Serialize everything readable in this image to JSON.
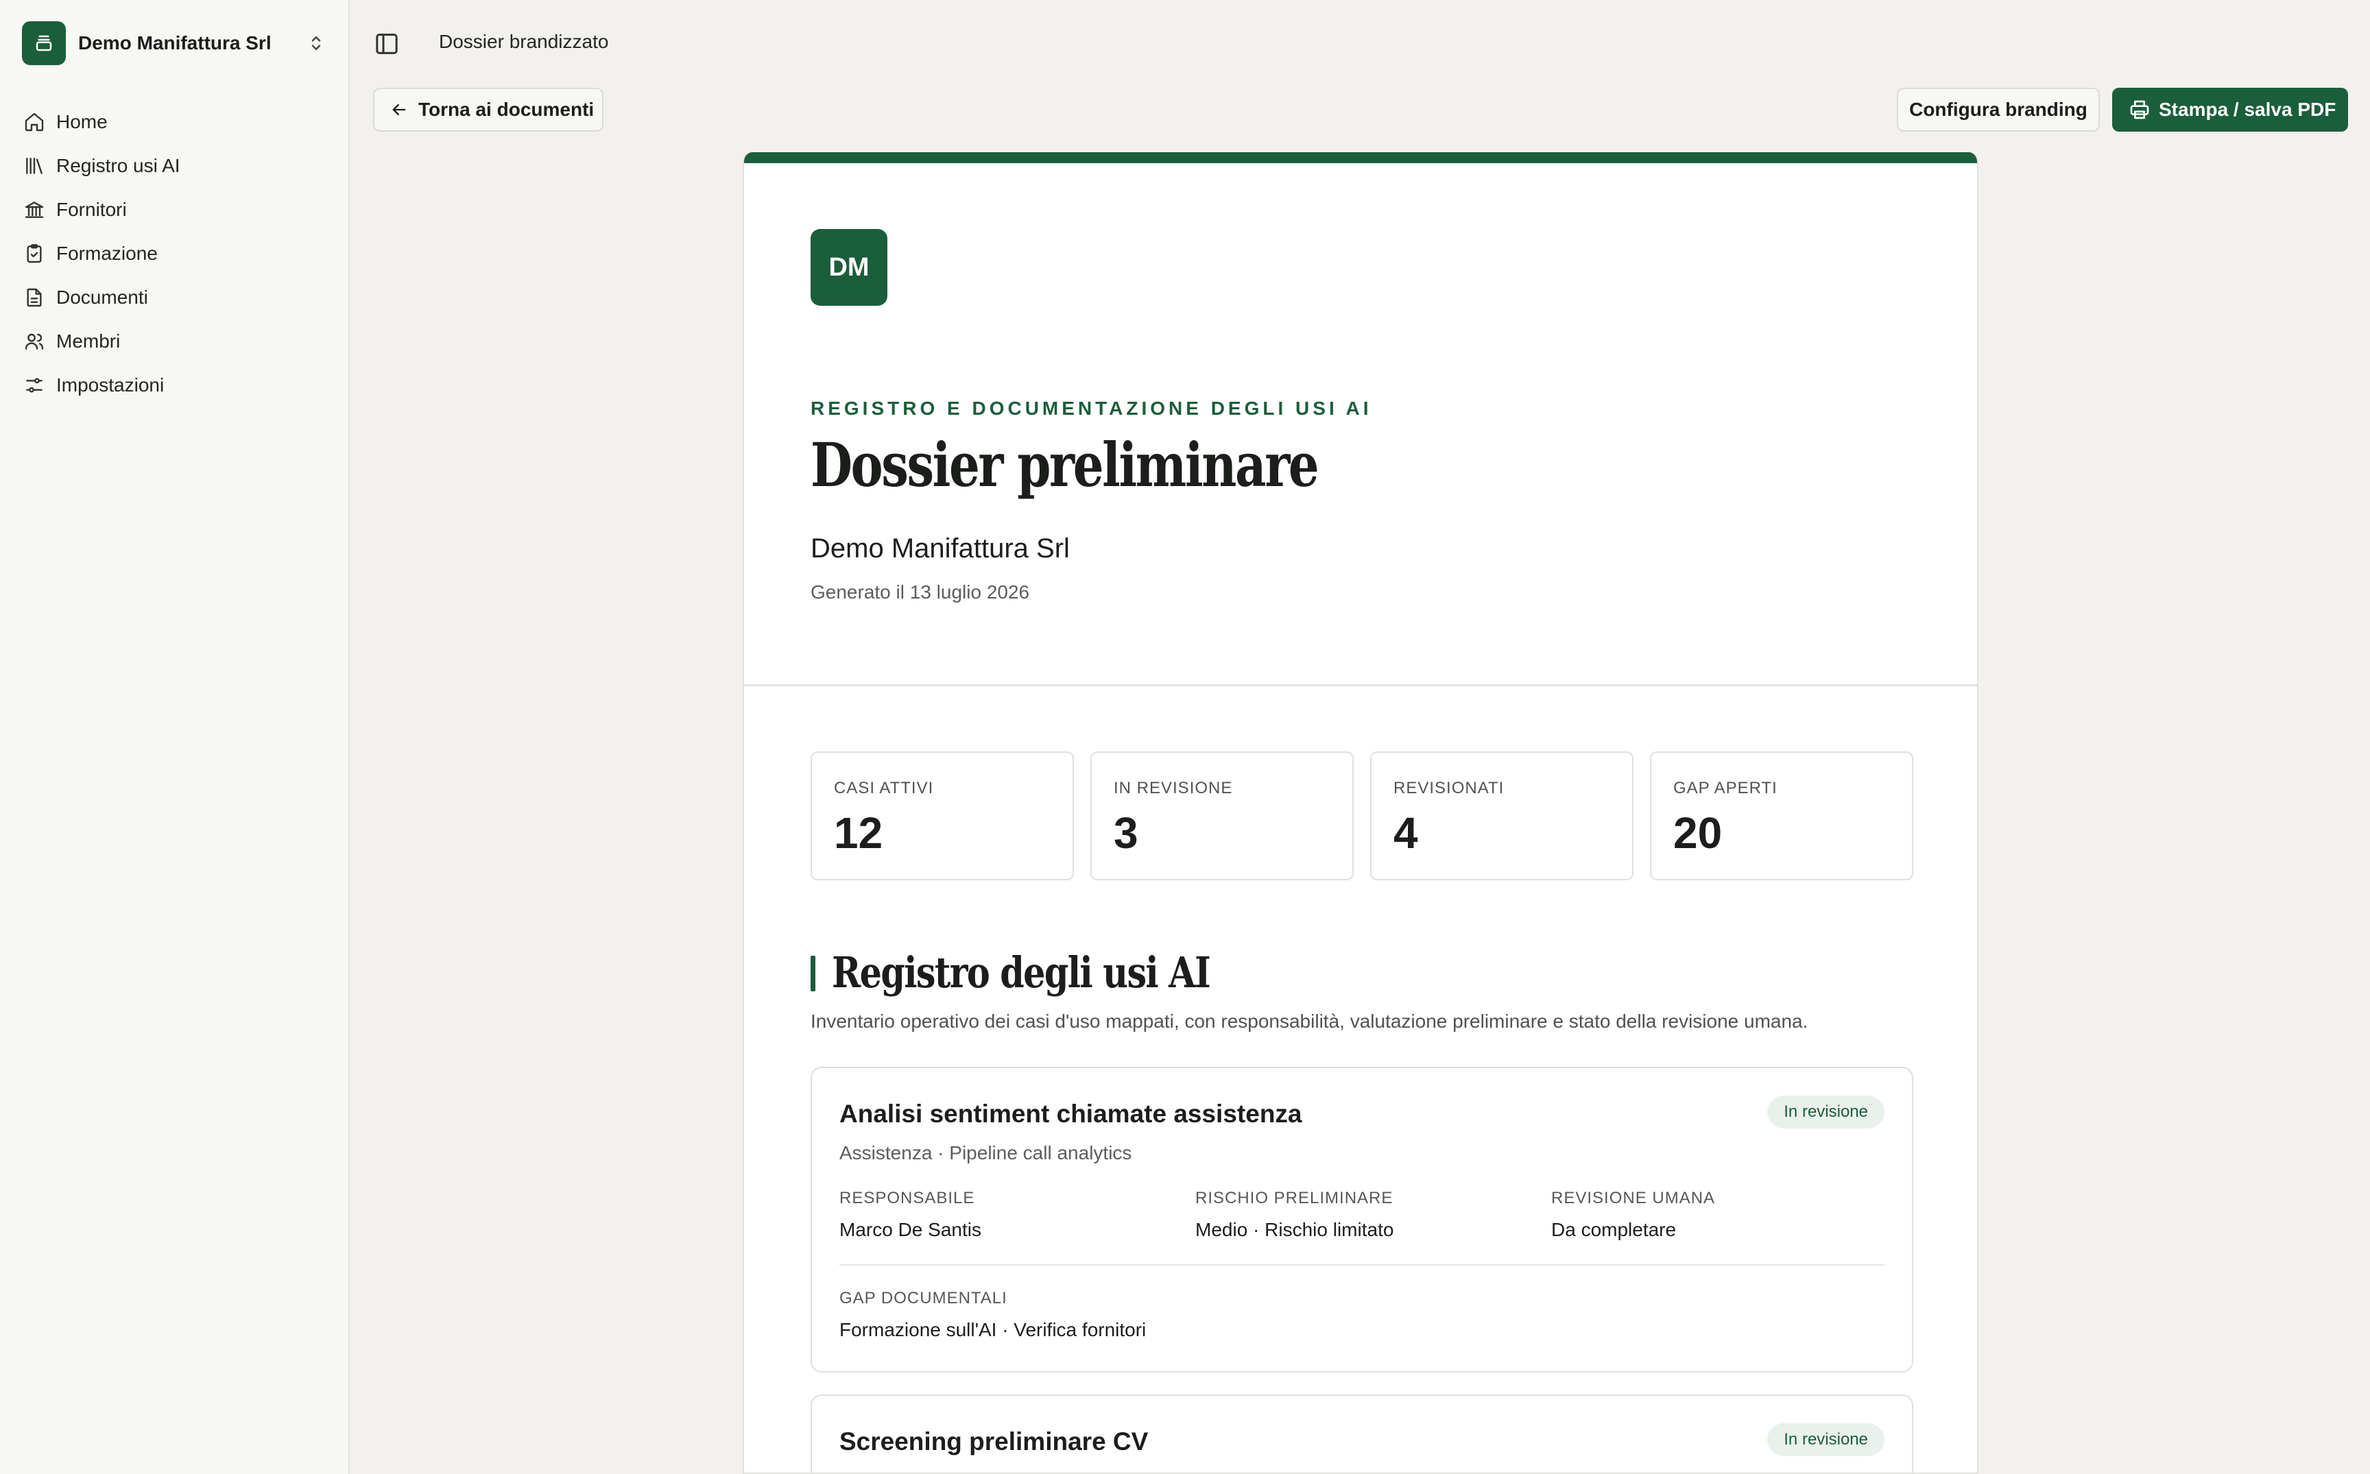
{
  "sidebar": {
    "org_name": "Demo Manifattura Srl",
    "items": [
      {
        "label": "Home",
        "icon": "home-icon"
      },
      {
        "label": "Registro usi AI",
        "icon": "library-icon"
      },
      {
        "label": "Fornitori",
        "icon": "bank-icon"
      },
      {
        "label": "Formazione",
        "icon": "clipboard-check-icon"
      },
      {
        "label": "Documenti",
        "icon": "file-text-icon"
      },
      {
        "label": "Membri",
        "icon": "users-icon"
      },
      {
        "label": "Impostazioni",
        "icon": "sliders-icon"
      }
    ]
  },
  "topbar": {
    "title": "Dossier brandizzato",
    "back_label": "Torna ai documenti",
    "branding_label": "Configura branding",
    "print_label": "Stampa / salva PDF"
  },
  "document": {
    "logo_initials": "DM",
    "eyebrow": "REGISTRO E DOCUMENTAZIONE DEGLI USI AI",
    "title": "Dossier preliminare",
    "org": "Demo Manifattura Srl",
    "generated": "Generato il 13 luglio 2026",
    "stats": [
      {
        "label": "CASI ATTIVI",
        "value": "12"
      },
      {
        "label": "IN REVISIONE",
        "value": "3"
      },
      {
        "label": "REVISIONATI",
        "value": "4"
      },
      {
        "label": "GAP APERTI",
        "value": "20"
      }
    ],
    "section": {
      "title": "Registro degli usi AI",
      "description": "Inventario operativo dei casi d'uso mappati, con responsabilità, valutazione preliminare e stato della revisione umana."
    },
    "cases": [
      {
        "title": "Analisi sentiment chiamate assistenza",
        "subtitle": "Assistenza · Pipeline call analytics",
        "status": "In revisione",
        "fields": {
          "owner_label": "RESPONSABILE",
          "owner": "Marco De Santis",
          "risk_label": "RISCHIO PRELIMINARE",
          "risk": "Medio · Rischio limitato",
          "review_label": "REVISIONE UMANA",
          "review": "Da completare",
          "gaps_label": "GAP DOCUMENTALI",
          "gaps": "Formazione sull'AI · Verifica fornitori"
        }
      },
      {
        "title": "Screening preliminare CV",
        "status": "In revisione"
      }
    ]
  },
  "colors": {
    "brand": "#1b5e3b",
    "background": "#f2f1ed",
    "sidebar": "#f7f7f4",
    "badge_bg": "#eaf1ec"
  }
}
